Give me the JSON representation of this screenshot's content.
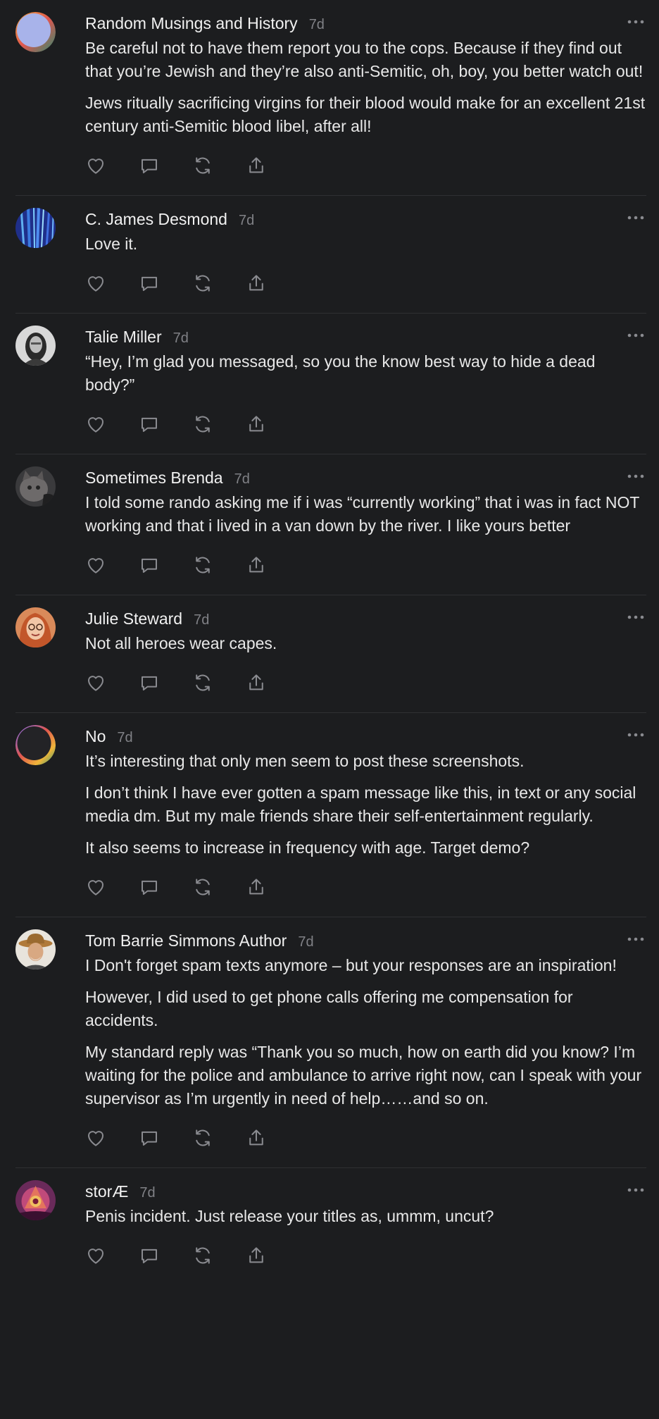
{
  "posts": [
    {
      "name": "Random Musings and History",
      "time": "7d",
      "avatar": "ring-blue-gradient-avatar",
      "paragraphs": [
        "Be careful not to have them report you to the cops. Because if they find out that you’re Jewish and they’re also anti-Semitic, oh, boy, you better watch out!",
        "Jews ritually sacrificing virgins for their blood would make for an excellent 21st century anti-Semitic blood libel, after all!"
      ]
    },
    {
      "name": "C. James Desmond",
      "time": "7d",
      "avatar": "blue-streaks-avatar",
      "paragraphs": [
        "Love it."
      ]
    },
    {
      "name": "Talie Miller",
      "time": "7d",
      "avatar": "grayscale-portrait-avatar",
      "paragraphs": [
        "“Hey, I’m glad you messaged, so you the know best way to hide a dead body?”"
      ]
    },
    {
      "name": "Sometimes Brenda",
      "time": "7d",
      "avatar": "cat-photo-avatar",
      "paragraphs": [
        "I told some rando asking me if i was “currently working” that i was in fact NOT working and that i lived in a van down by the river. I like yours better"
      ]
    },
    {
      "name": "Julie Steward",
      "time": "7d",
      "avatar": "redhead-portrait-avatar",
      "paragraphs": [
        "Not all heroes wear capes."
      ]
    },
    {
      "name": "No",
      "time": "7d",
      "avatar": "ring-dark-gradient-avatar",
      "paragraphs": [
        "It’s interesting that only men seem to post these screenshots.",
        "I don’t think I have ever gotten a spam message like this, in text or any social media dm. But my male friends share their self-entertainment regularly.",
        "It also seems to increase in frequency with age. Target demo?"
      ]
    },
    {
      "name": "Tom Barrie Simmons Author",
      "time": "7d",
      "avatar": "man-hat-portrait-avatar",
      "paragraphs": [
        "I Don't forget spam texts anymore – but your responses are an inspiration!",
        "However, I did used to get phone calls offering me compensation for accidents.",
        "My standard reply was “Thank you so much, how on earth did you know? I’m waiting for the police and ambulance to arrive right now, can I speak with your supervisor as I’m urgently in need of help……and so on."
      ]
    },
    {
      "name": "storÆ",
      "time": "7d",
      "avatar": "pink-fantasy-avatar",
      "paragraphs": [
        "Penis incident. Just release your titles as, ummm, uncut?"
      ]
    }
  ],
  "actions": [
    "heart-icon",
    "comment-icon",
    "restack-icon",
    "share-icon"
  ],
  "more_icon": "more-dots-icon",
  "colors": {
    "background": "#1c1d1f",
    "text": "#e8e8e8",
    "muted": "#808186",
    "icon": "#8a8b90",
    "divider": "#2f3033"
  }
}
